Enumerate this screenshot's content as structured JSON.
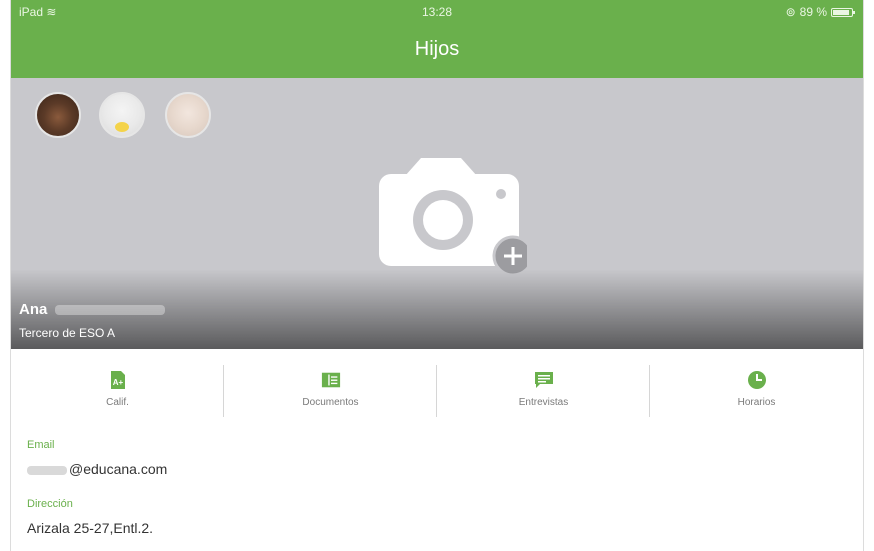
{
  "status_bar": {
    "device": "iPad",
    "time": "13:28",
    "battery": "89 %"
  },
  "header": {
    "title": "Hijos"
  },
  "child": {
    "name": "Ana",
    "class": "Tercero de ESO A"
  },
  "actions": [
    {
      "label": "Calif.",
      "icon": "grades-doc-icon"
    },
    {
      "label": "Documentos",
      "icon": "documents-icon"
    },
    {
      "label": "Entrevistas",
      "icon": "interview-chat-icon"
    },
    {
      "label": "Horarios",
      "icon": "clock-icon"
    }
  ],
  "fields": {
    "email": {
      "label": "Email",
      "value": "@educana.com"
    },
    "address": {
      "label": "Dirección",
      "value": "Arizala 25-27,Entl.2."
    }
  },
  "colors": {
    "accent": "#6ab04c",
    "hero_bg": "#c8c8cc"
  }
}
